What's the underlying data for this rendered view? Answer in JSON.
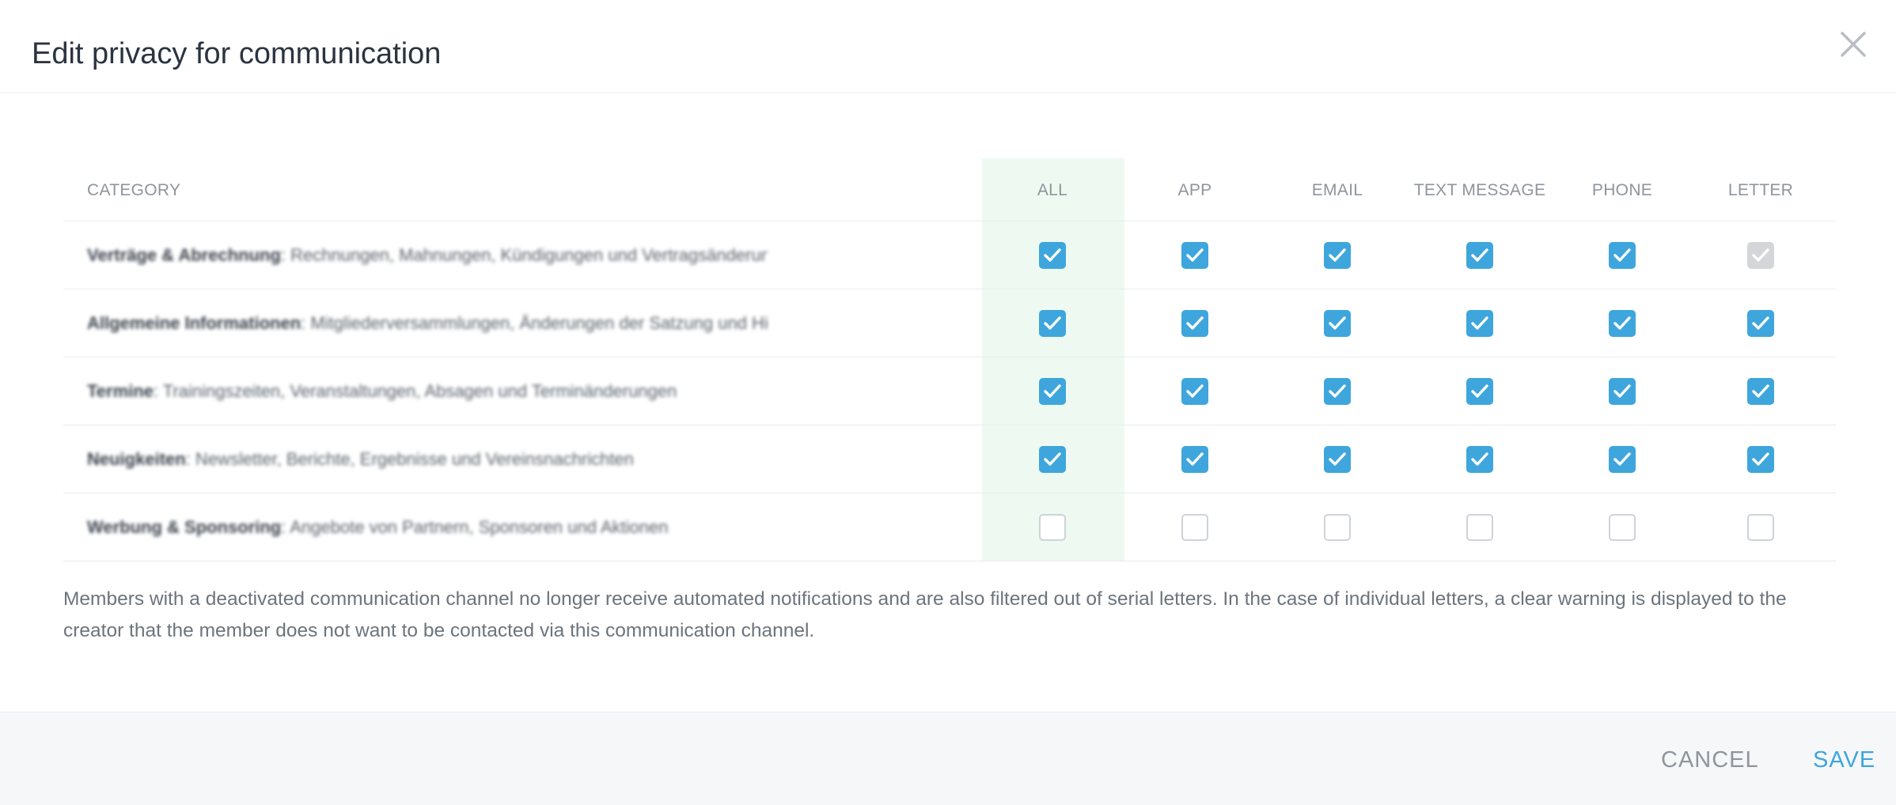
{
  "dialog": {
    "title": "Edit privacy for communication"
  },
  "table": {
    "category_header": "CATEGORY",
    "columns": [
      "ALL",
      "APP",
      "EMAIL",
      "TEXT MESSAGE",
      "PHONE",
      "LETTER"
    ],
    "rows": [
      {
        "label_strong": "Verträge & Abrechnung",
        "label_rest": ": Rechnungen, Mahnungen, Kündigungen und Vertragsänderungen",
        "checks": [
          "checked",
          "checked",
          "checked",
          "checked",
          "checked",
          "disabled"
        ]
      },
      {
        "label_strong": "Allgemeine Informationen",
        "label_rest": ": Mitgliederversammlungen, Änderungen der Satzung und Hinweise",
        "checks": [
          "checked",
          "checked",
          "checked",
          "checked",
          "checked",
          "checked"
        ]
      },
      {
        "label_strong": "Termine",
        "label_rest": ": Trainingszeiten, Veranstaltungen, Absagen und Terminänderungen",
        "checks": [
          "checked",
          "checked",
          "checked",
          "checked",
          "checked",
          "checked"
        ]
      },
      {
        "label_strong": "Neuigkeiten",
        "label_rest": ": Newsletter, Berichte, Ergebnisse und Vereinsnachrichten",
        "checks": [
          "checked",
          "checked",
          "checked",
          "checked",
          "checked",
          "checked"
        ]
      },
      {
        "label_strong": "Werbung & Sponsoring",
        "label_rest": ": Angebote von Partnern, Sponsoren und Aktionen",
        "checks": [
          "unchecked",
          "unchecked",
          "unchecked",
          "unchecked",
          "unchecked",
          "unchecked"
        ]
      }
    ]
  },
  "note": "Members with a deactivated communication channel no longer receive automated notifications and are also filtered out of serial letters. In the case of individual letters, a clear warning is displayed to the creator that the member does not want to be contacted via this communication channel.",
  "footer": {
    "cancel_label": "CANCEL",
    "save_label": "SAVE"
  },
  "icons": {
    "close": "close-icon",
    "check": "checkmark-icon"
  },
  "colors": {
    "accent": "#3ea6dc",
    "all_column_highlight": "#eefaf1",
    "disabled_checkbox": "#d4d6d9",
    "footer_background": "#f6f7f9"
  }
}
